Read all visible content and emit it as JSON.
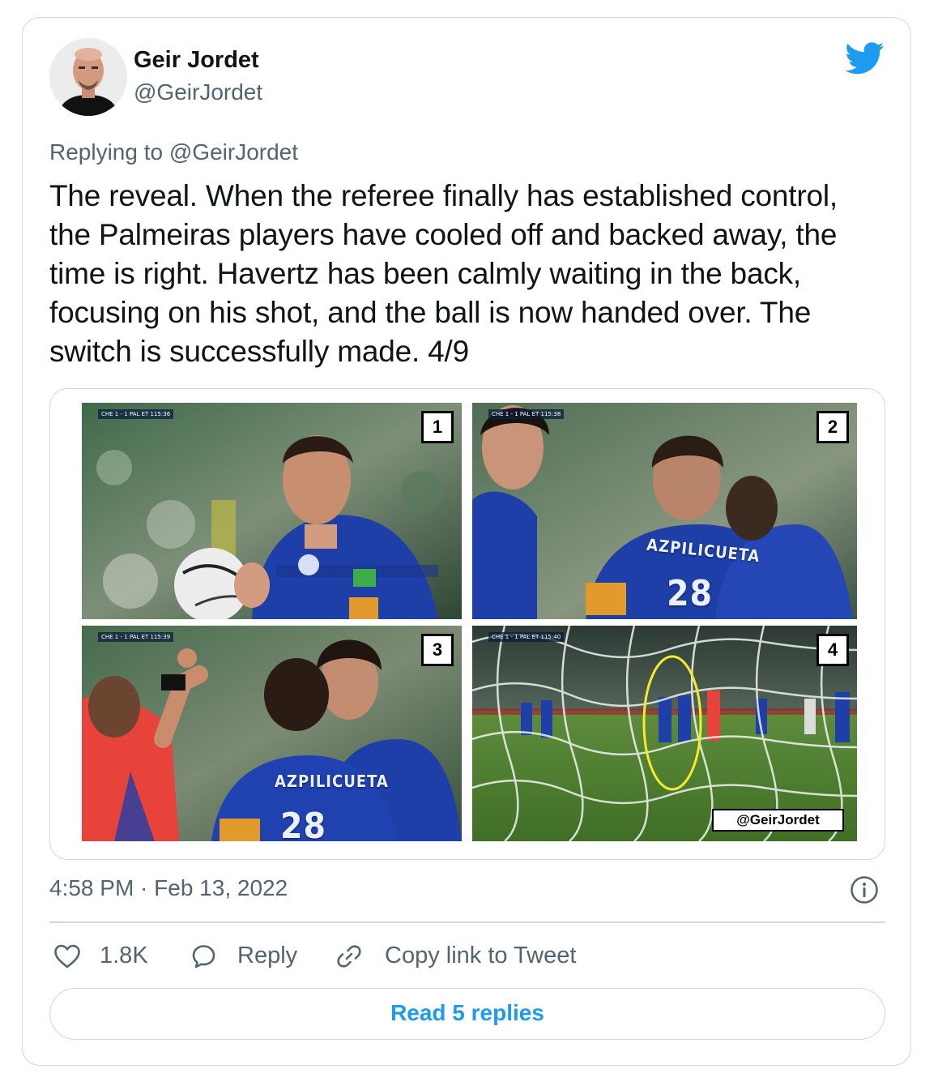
{
  "author": {
    "display_name": "Geir Jordet",
    "handle": "@GeirJordet"
  },
  "reply_context": {
    "prefix": "Replying to ",
    "handle": "@GeirJordet"
  },
  "tweet": {
    "text": "The reveal. When the referee finally has established control, the Palmeiras players have cooled off and backed away, the time is right. Havertz has been calmly waiting in the back, focusing on his shot, and the ball is now handed over. The switch is successfully made. 4/9",
    "timestamp": "4:58 PM · Feb 13, 2022"
  },
  "media": {
    "panels": [
      {
        "number": "1",
        "scorebug": "CHE 1 - 1 PAL ET 115:36"
      },
      {
        "number": "2",
        "scorebug": "CHE 1 - 1 PAL ET 115:38",
        "jersey_name": "AZPILICUETA",
        "jersey_number": "28"
      },
      {
        "number": "3",
        "scorebug": "CHE 1 - 1 PAL ET 115:39",
        "jersey_name": "AZPILICUETA",
        "jersey_number": "28"
      },
      {
        "number": "4",
        "scorebug": "CHE 1 - 1 PAL ET 115:40",
        "watermark": "@GeirJordet"
      }
    ]
  },
  "actions": {
    "like_count": "1.8K",
    "reply_label": "Reply",
    "copy_link_label": "Copy link to Tweet"
  },
  "read_replies_label": "Read 5 replies",
  "colors": {
    "accent": "#1d9bf0",
    "secondary_text": "#536471",
    "border": "#cfd9de",
    "chelsea_blue": "#1e3fa8"
  },
  "icons": {
    "brand": "twitter-bird-icon",
    "info": "info-icon",
    "like": "heart-icon",
    "reply": "speech-bubble-icon",
    "copy": "link-icon"
  }
}
